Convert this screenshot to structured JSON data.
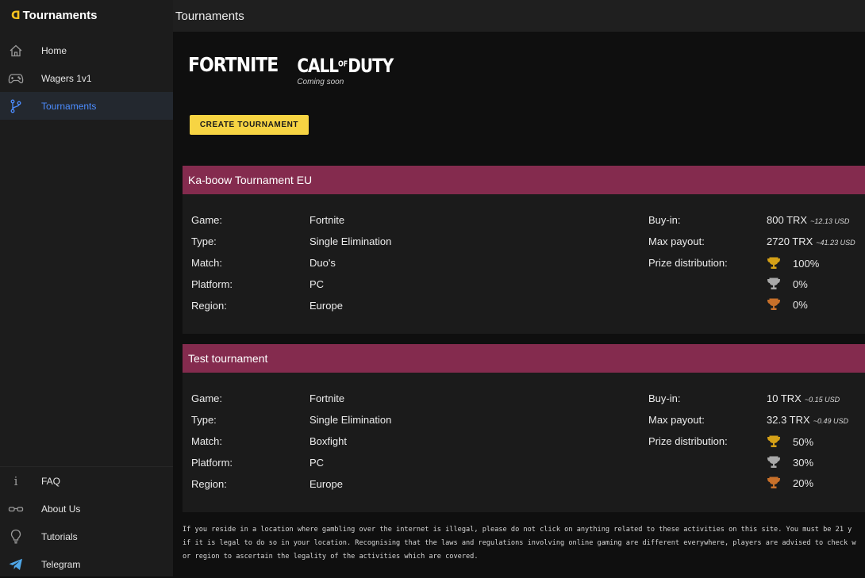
{
  "brand": {
    "name": "Tournaments"
  },
  "nav_top": [
    {
      "label": "Home",
      "icon": "home-icon"
    },
    {
      "label": "Wagers 1v1",
      "icon": "gamepad-icon"
    },
    {
      "label": "Tournaments",
      "icon": "branch-icon",
      "active": true
    }
  ],
  "nav_bottom": [
    {
      "label": "FAQ",
      "icon": "info-icon"
    },
    {
      "label": "About Us",
      "icon": "glasses-icon"
    },
    {
      "label": "Tutorials",
      "icon": "lightbulb-icon"
    },
    {
      "label": "Telegram",
      "icon": "telegram-icon"
    }
  ],
  "header": {
    "title": "Tournaments"
  },
  "games": {
    "fortnite": "FORTNITE",
    "cod_main": "CALL",
    "cod_small": "OF",
    "cod_end": "DUTY",
    "cod_soon": "Coming soon"
  },
  "create_button": "CREATE TOURNAMENT",
  "labels": {
    "game": "Game:",
    "type": "Type:",
    "match": "Match:",
    "platform": "Platform:",
    "region": "Region:",
    "buyin": "Buy-in:",
    "max_payout": "Max payout:",
    "prize_distribution": "Prize distribution:"
  },
  "tournaments": [
    {
      "name": "Ka-boow Tournament EU",
      "game": "Fortnite",
      "type": "Single Elimination",
      "match": "Duo's",
      "platform": "PC",
      "region": "Europe",
      "buyin": "800 TRX",
      "buyin_usd": "~12.13 USD",
      "max_payout": "2720 TRX",
      "max_payout_usd": "~41.23 USD",
      "prizes": [
        "100%",
        "0%",
        "0%"
      ]
    },
    {
      "name": "Test tournament",
      "game": "Fortnite",
      "type": "Single Elimination",
      "match": "Boxfight",
      "platform": "PC",
      "region": "Europe",
      "buyin": "10 TRX",
      "buyin_usd": "~0.15 USD",
      "max_payout": "32.3 TRX",
      "max_payout_usd": "~0.49 USD",
      "prizes": [
        "50%",
        "30%",
        "20%"
      ]
    }
  ],
  "colors": {
    "accent": "#f7d443",
    "card_header": "#842b4e",
    "active_nav": "#4c8dff",
    "gold": "#d4a017",
    "silver": "#a9a9a9",
    "bronze": "#c8702a"
  },
  "disclaimer": [
    "If you reside in a location where gambling over the internet is illegal, please do not click on anything related to these activities on this site. You must be 21 y",
    "if it is legal to do so in your location. Recognising that the laws and regulations involving online gaming are different everywhere, players are advised to check w",
    "or region to ascertain the legality of the activities which are covered."
  ]
}
